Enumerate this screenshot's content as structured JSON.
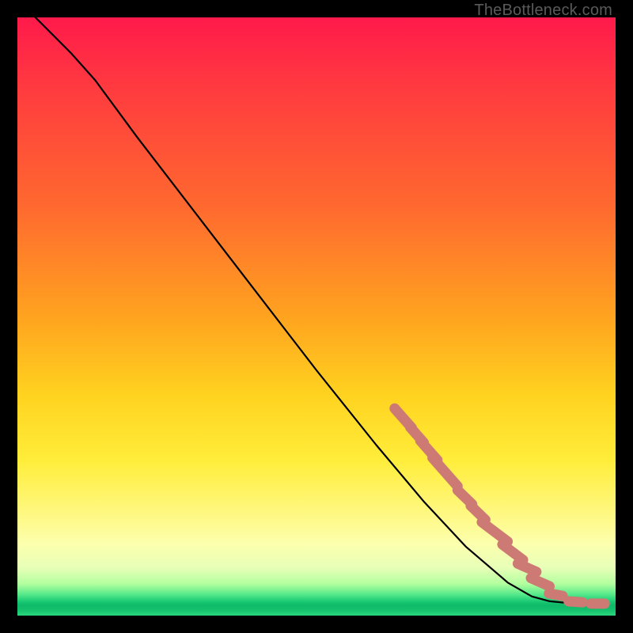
{
  "watermark": "TheBottleneck.com",
  "chart_data": {
    "type": "line",
    "title": "",
    "xlabel": "",
    "ylabel": "",
    "xlim": [
      0,
      100
    ],
    "ylim": [
      0,
      100
    ],
    "grid": false,
    "curve": [
      {
        "x": 3,
        "y": 100
      },
      {
        "x": 6,
        "y": 97
      },
      {
        "x": 9,
        "y": 94
      },
      {
        "x": 13,
        "y": 89.5
      },
      {
        "x": 20,
        "y": 80
      },
      {
        "x": 30,
        "y": 67
      },
      {
        "x": 40,
        "y": 54
      },
      {
        "x": 50,
        "y": 41
      },
      {
        "x": 60,
        "y": 28.5
      },
      {
        "x": 68,
        "y": 19
      },
      {
        "x": 75,
        "y": 11.5
      },
      {
        "x": 82,
        "y": 5.5
      },
      {
        "x": 86,
        "y": 3.2
      },
      {
        "x": 89,
        "y": 2.4
      },
      {
        "x": 92,
        "y": 2.1
      },
      {
        "x": 95,
        "y": 2.0
      },
      {
        "x": 98,
        "y": 2.0
      }
    ],
    "markers": [
      {
        "x": 64.5,
        "y": 33,
        "len": 3.9
      },
      {
        "x": 66.8,
        "y": 30.2,
        "len": 3.3
      },
      {
        "x": 68.8,
        "y": 27.6,
        "len": 3.9
      },
      {
        "x": 71.5,
        "y": 24.0,
        "len": 5.2
      },
      {
        "x": 74.8,
        "y": 19.8,
        "len": 3.3
      },
      {
        "x": 77.0,
        "y": 17.2,
        "len": 3.3
      },
      {
        "x": 79.8,
        "y": 14.0,
        "len": 4.6
      },
      {
        "x": 82.8,
        "y": 10.6,
        "len": 3.9
      },
      {
        "x": 85.2,
        "y": 8.0,
        "len": 3.3
      },
      {
        "x": 87.4,
        "y": 5.6,
        "len": 3.3
      },
      {
        "x": 90.0,
        "y": 3.5,
        "len": 2.6
      },
      {
        "x": 93.3,
        "y": 2.3,
        "len": 2.6
      },
      {
        "x": 97.0,
        "y": 2.0,
        "len": 2.6
      }
    ]
  }
}
